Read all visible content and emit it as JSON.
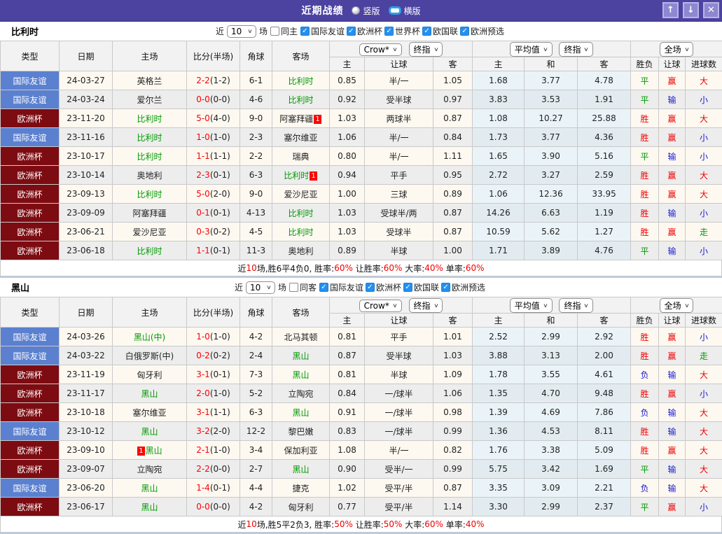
{
  "titlebar": {
    "title": "近期战绩",
    "vertical_label": "竖版",
    "horizontal_label": "横版",
    "selected": "横版",
    "buttons": {
      "up": "↑",
      "down": "↓",
      "close": "✕"
    }
  },
  "table_header": {
    "cols": [
      "类型",
      "日期",
      "主场",
      "比分(半场)",
      "角球",
      "客场"
    ],
    "sub": [
      "主",
      "让球",
      "客",
      "主",
      "和",
      "客",
      "胜负",
      "让球",
      "进球数"
    ],
    "selects": {
      "book": "Crow*",
      "final_a": "终指",
      "avg": "平均值",
      "final_b": "终指",
      "scope": "全场"
    }
  },
  "sections": [
    {
      "team": "比利时",
      "filter": {
        "near": "近",
        "count": "10",
        "games": "场",
        "same": "同主",
        "same_checked": false,
        "competitions": [
          "国际友谊",
          "欧洲杯",
          "世界杯",
          "欧国联",
          "欧洲预选"
        ]
      },
      "rows": [
        {
          "type": "国际友谊",
          "tk": "friendly",
          "date": "24-03-27",
          "home": "英格兰",
          "hg": false,
          "hb": null,
          "score": "2-2",
          "half": "(1-2)",
          "corner": "6-1",
          "away": "比利时",
          "ag": true,
          "ab": null,
          "ch": "0.85",
          "line": "半/一",
          "ca": "1.05",
          "ah": "1.68",
          "ad": "3.77",
          "aa": "4.78",
          "res": {
            "t": "平",
            "c": "g"
          },
          "asia": {
            "t": "赢",
            "c": "r"
          },
          "goal": {
            "t": "大",
            "c": "r"
          }
        },
        {
          "type": "国际友谊",
          "tk": "friendly",
          "date": "24-03-24",
          "home": "爱尔兰",
          "hg": false,
          "hb": null,
          "score": "0-0",
          "half": "(0-0)",
          "corner": "4-6",
          "away": "比利时",
          "ag": true,
          "ab": null,
          "ch": "0.92",
          "line": "受半球",
          "ca": "0.97",
          "ah": "3.83",
          "ad": "3.53",
          "aa": "1.91",
          "res": {
            "t": "平",
            "c": "g"
          },
          "asia": {
            "t": "输",
            "c": "b"
          },
          "goal": {
            "t": "小",
            "c": "b"
          }
        },
        {
          "type": "欧洲杯",
          "tk": "eurocup",
          "date": "23-11-20",
          "home": "比利时",
          "hg": true,
          "hb": null,
          "score": "5-0",
          "half": "(4-0)",
          "corner": "9-0",
          "away": "阿塞拜疆",
          "ag": false,
          "ab": {
            "pos": "after",
            "text": "1"
          },
          "ch": "1.03",
          "line": "两球半",
          "ca": "0.87",
          "ah": "1.08",
          "ad": "10.27",
          "aa": "25.88",
          "res": {
            "t": "胜",
            "c": "r"
          },
          "asia": {
            "t": "赢",
            "c": "r"
          },
          "goal": {
            "t": "大",
            "c": "r"
          }
        },
        {
          "type": "国际友谊",
          "tk": "friendly",
          "date": "23-11-16",
          "home": "比利时",
          "hg": true,
          "hb": null,
          "score": "1-0",
          "half": "(1-0)",
          "corner": "2-3",
          "away": "塞尔维亚",
          "ag": false,
          "ab": null,
          "ch": "1.06",
          "line": "半/一",
          "ca": "0.84",
          "ah": "1.73",
          "ad": "3.77",
          "aa": "4.36",
          "res": {
            "t": "胜",
            "c": "r"
          },
          "asia": {
            "t": "赢",
            "c": "r"
          },
          "goal": {
            "t": "小",
            "c": "b"
          }
        },
        {
          "type": "欧洲杯",
          "tk": "eurocup",
          "date": "23-10-17",
          "home": "比利时",
          "hg": true,
          "hb": null,
          "score": "1-1",
          "half": "(1-1)",
          "corner": "2-2",
          "away": "瑞典",
          "ag": false,
          "ab": null,
          "ch": "0.80",
          "line": "半/一",
          "ca": "1.11",
          "ah": "1.65",
          "ad": "3.90",
          "aa": "5.16",
          "res": {
            "t": "平",
            "c": "g"
          },
          "asia": {
            "t": "输",
            "c": "b"
          },
          "goal": {
            "t": "小",
            "c": "b"
          }
        },
        {
          "type": "欧洲杯",
          "tk": "eurocup",
          "date": "23-10-14",
          "home": "奥地利",
          "hg": false,
          "hb": null,
          "score": "2-3",
          "half": "(0-1)",
          "corner": "6-3",
          "away": "比利时",
          "ag": true,
          "ab": {
            "pos": "after",
            "text": "1"
          },
          "ch": "0.94",
          "line": "平手",
          "ca": "0.95",
          "ah": "2.72",
          "ad": "3.27",
          "aa": "2.59",
          "res": {
            "t": "胜",
            "c": "r"
          },
          "asia": {
            "t": "赢",
            "c": "r"
          },
          "goal": {
            "t": "大",
            "c": "r"
          }
        },
        {
          "type": "欧洲杯",
          "tk": "eurocup",
          "date": "23-09-13",
          "home": "比利时",
          "hg": true,
          "hb": null,
          "score": "5-0",
          "half": "(2-0)",
          "corner": "9-0",
          "away": "爱沙尼亚",
          "ag": false,
          "ab": null,
          "ch": "1.00",
          "line": "三球",
          "ca": "0.89",
          "ah": "1.06",
          "ad": "12.36",
          "aa": "33.95",
          "res": {
            "t": "胜",
            "c": "r"
          },
          "asia": {
            "t": "赢",
            "c": "r"
          },
          "goal": {
            "t": "大",
            "c": "r"
          }
        },
        {
          "type": "欧洲杯",
          "tk": "eurocup",
          "date": "23-09-09",
          "home": "阿塞拜疆",
          "hg": false,
          "hb": null,
          "score": "0-1",
          "half": "(0-1)",
          "corner": "4-13",
          "away": "比利时",
          "ag": true,
          "ab": null,
          "ch": "1.03",
          "line": "受球半/两",
          "ca": "0.87",
          "ah": "14.26",
          "ad": "6.63",
          "aa": "1.19",
          "res": {
            "t": "胜",
            "c": "r"
          },
          "asia": {
            "t": "输",
            "c": "b"
          },
          "goal": {
            "t": "小",
            "c": "b"
          }
        },
        {
          "type": "欧洲杯",
          "tk": "eurocup",
          "date": "23-06-21",
          "home": "爱沙尼亚",
          "hg": false,
          "hb": null,
          "score": "0-3",
          "half": "(0-2)",
          "corner": "4-5",
          "away": "比利时",
          "ag": true,
          "ab": null,
          "ch": "1.03",
          "line": "受球半",
          "ca": "0.87",
          "ah": "10.59",
          "ad": "5.62",
          "aa": "1.27",
          "res": {
            "t": "胜",
            "c": "r"
          },
          "asia": {
            "t": "赢",
            "c": "r"
          },
          "goal": {
            "t": "走",
            "c": "g"
          }
        },
        {
          "type": "欧洲杯",
          "tk": "eurocup",
          "date": "23-06-18",
          "home": "比利时",
          "hg": true,
          "hb": null,
          "score": "1-1",
          "half": "(0-1)",
          "corner": "11-3",
          "away": "奥地利",
          "ag": false,
          "ab": null,
          "ch": "0.89",
          "line": "半球",
          "ca": "1.00",
          "ah": "1.71",
          "ad": "3.89",
          "aa": "4.76",
          "res": {
            "t": "平",
            "c": "g"
          },
          "asia": {
            "t": "输",
            "c": "b"
          },
          "goal": {
            "t": "小",
            "c": "b"
          }
        }
      ],
      "summary": [
        {
          "t": "近",
          "c": "k"
        },
        {
          "t": "10",
          "c": "r"
        },
        {
          "t": "场,胜6平4负0, 胜率:",
          "c": "k"
        },
        {
          "t": "60%",
          "c": "r"
        },
        {
          "t": " 让胜率:",
          "c": "k"
        },
        {
          "t": "60%",
          "c": "r"
        },
        {
          "t": " 大率:",
          "c": "k"
        },
        {
          "t": "40%",
          "c": "r"
        },
        {
          "t": " 单率:",
          "c": "k"
        },
        {
          "t": "60%",
          "c": "r"
        }
      ]
    },
    {
      "team": "黑山",
      "filter": {
        "near": "近",
        "count": "10",
        "games": "场",
        "same": "同客",
        "same_checked": false,
        "competitions": [
          "国际友谊",
          "欧洲杯",
          "欧国联",
          "欧洲预选"
        ]
      },
      "rows": [
        {
          "type": "国际友谊",
          "tk": "friendly",
          "date": "24-03-26",
          "home": "黑山(中)",
          "hg": true,
          "hb": null,
          "score": "1-0",
          "half": "(1-0)",
          "corner": "4-2",
          "away": "北马其顿",
          "ag": false,
          "ab": null,
          "ch": "0.81",
          "line": "平手",
          "ca": "1.01",
          "ah": "2.52",
          "ad": "2.99",
          "aa": "2.92",
          "res": {
            "t": "胜",
            "c": "r"
          },
          "asia": {
            "t": "赢",
            "c": "r"
          },
          "goal": {
            "t": "小",
            "c": "b"
          }
        },
        {
          "type": "国际友谊",
          "tk": "friendly",
          "date": "24-03-22",
          "home": "白俄罗斯(中)",
          "hg": false,
          "hb": null,
          "score": "0-2",
          "half": "(0-2)",
          "corner": "2-4",
          "away": "黑山",
          "ag": true,
          "ab": null,
          "ch": "0.87",
          "line": "受半球",
          "ca": "1.03",
          "ah": "3.88",
          "ad": "3.13",
          "aa": "2.00",
          "res": {
            "t": "胜",
            "c": "r"
          },
          "asia": {
            "t": "赢",
            "c": "r"
          },
          "goal": {
            "t": "走",
            "c": "g"
          }
        },
        {
          "type": "欧洲杯",
          "tk": "eurocup",
          "date": "23-11-19",
          "home": "匈牙利",
          "hg": false,
          "hb": null,
          "score": "3-1",
          "half": "(0-1)",
          "corner": "7-3",
          "away": "黑山",
          "ag": true,
          "ab": null,
          "ch": "0.81",
          "line": "半球",
          "ca": "1.09",
          "ah": "1.78",
          "ad": "3.55",
          "aa": "4.61",
          "res": {
            "t": "负",
            "c": "b"
          },
          "asia": {
            "t": "输",
            "c": "b"
          },
          "goal": {
            "t": "大",
            "c": "r"
          }
        },
        {
          "type": "欧洲杯",
          "tk": "eurocup",
          "date": "23-11-17",
          "home": "黑山",
          "hg": true,
          "hb": null,
          "score": "2-0",
          "half": "(1-0)",
          "corner": "5-2",
          "away": "立陶宛",
          "ag": false,
          "ab": null,
          "ch": "0.84",
          "line": "一/球半",
          "ca": "1.06",
          "ah": "1.35",
          "ad": "4.70",
          "aa": "9.48",
          "res": {
            "t": "胜",
            "c": "r"
          },
          "asia": {
            "t": "赢",
            "c": "r"
          },
          "goal": {
            "t": "小",
            "c": "b"
          }
        },
        {
          "type": "欧洲杯",
          "tk": "eurocup",
          "date": "23-10-18",
          "home": "塞尔维亚",
          "hg": false,
          "hb": null,
          "score": "3-1",
          "half": "(1-1)",
          "corner": "6-3",
          "away": "黑山",
          "ag": true,
          "ab": null,
          "ch": "0.91",
          "line": "一/球半",
          "ca": "0.98",
          "ah": "1.39",
          "ad": "4.69",
          "aa": "7.86",
          "res": {
            "t": "负",
            "c": "b"
          },
          "asia": {
            "t": "输",
            "c": "b"
          },
          "goal": {
            "t": "大",
            "c": "r"
          }
        },
        {
          "type": "国际友谊",
          "tk": "friendly",
          "date": "23-10-12",
          "home": "黑山",
          "hg": true,
          "hb": null,
          "score": "3-2",
          "half": "(2-0)",
          "corner": "12-2",
          "away": "黎巴嫩",
          "ag": false,
          "ab": null,
          "ch": "0.83",
          "line": "一/球半",
          "ca": "0.99",
          "ah": "1.36",
          "ad": "4.53",
          "aa": "8.11",
          "res": {
            "t": "胜",
            "c": "r"
          },
          "asia": {
            "t": "输",
            "c": "b"
          },
          "goal": {
            "t": "大",
            "c": "r"
          }
        },
        {
          "type": "欧洲杯",
          "tk": "eurocup",
          "date": "23-09-10",
          "home": "黑山",
          "hg": true,
          "hb": {
            "pos": "before",
            "text": "1"
          },
          "score": "2-1",
          "half": "(1-0)",
          "corner": "3-4",
          "away": "保加利亚",
          "ag": false,
          "ab": null,
          "ch": "1.08",
          "line": "半/一",
          "ca": "0.82",
          "ah": "1.76",
          "ad": "3.38",
          "aa": "5.09",
          "res": {
            "t": "胜",
            "c": "r"
          },
          "asia": {
            "t": "赢",
            "c": "r"
          },
          "goal": {
            "t": "大",
            "c": "r"
          }
        },
        {
          "type": "欧洲杯",
          "tk": "eurocup",
          "date": "23-09-07",
          "home": "立陶宛",
          "hg": false,
          "hb": null,
          "score": "2-2",
          "half": "(0-0)",
          "corner": "2-7",
          "away": "黑山",
          "ag": true,
          "ab": null,
          "ch": "0.90",
          "line": "受半/一",
          "ca": "0.99",
          "ah": "5.75",
          "ad": "3.42",
          "aa": "1.69",
          "res": {
            "t": "平",
            "c": "g"
          },
          "asia": {
            "t": "输",
            "c": "b"
          },
          "goal": {
            "t": "大",
            "c": "r"
          }
        },
        {
          "type": "国际友谊",
          "tk": "friendly",
          "date": "23-06-20",
          "home": "黑山",
          "hg": true,
          "hb": null,
          "score": "1-4",
          "half": "(0-1)",
          "corner": "4-4",
          "away": "捷克",
          "ag": false,
          "ab": null,
          "ch": "1.02",
          "line": "受平/半",
          "ca": "0.87",
          "ah": "3.35",
          "ad": "3.09",
          "aa": "2.21",
          "res": {
            "t": "负",
            "c": "b"
          },
          "asia": {
            "t": "输",
            "c": "b"
          },
          "goal": {
            "t": "大",
            "c": "r"
          }
        },
        {
          "type": "欧洲杯",
          "tk": "eurocup",
          "date": "23-06-17",
          "home": "黑山",
          "hg": true,
          "hb": null,
          "score": "0-0",
          "half": "(0-0)",
          "corner": "4-2",
          "away": "匈牙利",
          "ag": false,
          "ab": null,
          "ch": "0.77",
          "line": "受平/半",
          "ca": "1.14",
          "ah": "3.30",
          "ad": "2.99",
          "aa": "2.37",
          "res": {
            "t": "平",
            "c": "g"
          },
          "asia": {
            "t": "赢",
            "c": "r"
          },
          "goal": {
            "t": "小",
            "c": "b"
          }
        }
      ],
      "summary": [
        {
          "t": "近",
          "c": "k"
        },
        {
          "t": "10",
          "c": "r"
        },
        {
          "t": "场,胜5平2负3, 胜率:",
          "c": "k"
        },
        {
          "t": "50%",
          "c": "r"
        },
        {
          "t": " 让胜率:",
          "c": "k"
        },
        {
          "t": "50%",
          "c": "r"
        },
        {
          "t": " 大率:",
          "c": "k"
        },
        {
          "t": "60%",
          "c": "r"
        },
        {
          "t": " 单率:",
          "c": "k"
        },
        {
          "t": "40%",
          "c": "r"
        }
      ]
    }
  ]
}
